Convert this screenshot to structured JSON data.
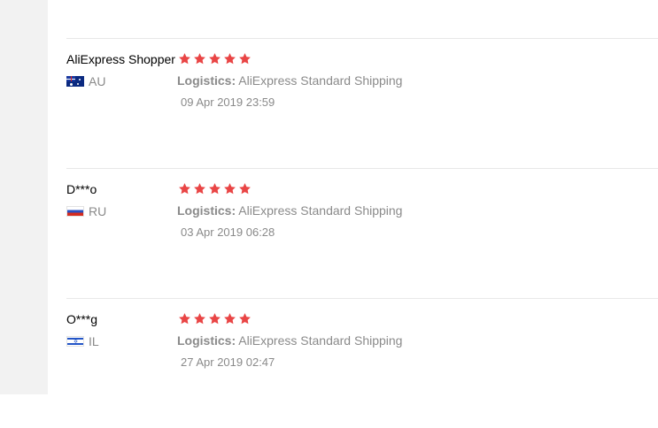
{
  "colors": {
    "star": "#e94545",
    "divider": "#e8e8e8",
    "gutter": "#f2f2f2",
    "muted": "#8a8a8a"
  },
  "reviews": [
    {
      "user": "AliExpress Shopper",
      "country": "AU",
      "flag_icon": "australia-flag-icon",
      "rating": 5,
      "logistics_label": "Logistics:",
      "logistics_value": "AliExpress Standard Shipping",
      "date": "09 Apr 2019 23:59"
    },
    {
      "user": "D***o",
      "country": "RU",
      "flag_icon": "russia-flag-icon",
      "rating": 5,
      "logistics_label": "Logistics:",
      "logistics_value": "AliExpress Standard Shipping",
      "date": "03 Apr 2019 06:28"
    },
    {
      "user": "O***g",
      "country": "IL",
      "flag_icon": "israel-flag-icon",
      "rating": 5,
      "logistics_label": "Logistics:",
      "logistics_value": "AliExpress Standard Shipping",
      "date": "27 Apr 2019 02:47"
    }
  ]
}
